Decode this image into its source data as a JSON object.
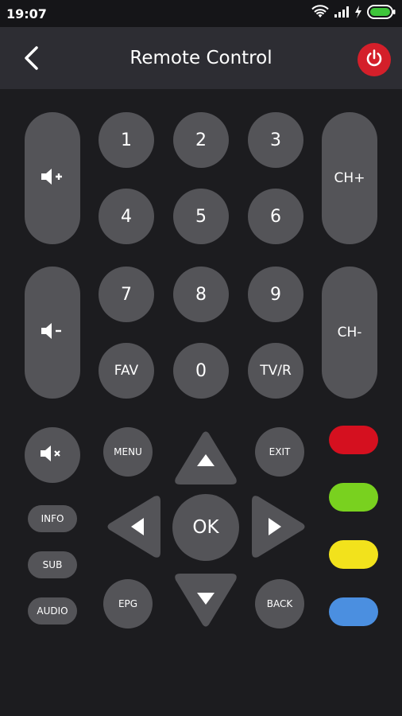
{
  "status": {
    "time": "19:07"
  },
  "appbar": {
    "title": "Remote Control"
  },
  "numbers": [
    "1",
    "2",
    "3",
    "4",
    "5",
    "6",
    "7",
    "8",
    "9",
    "0"
  ],
  "keys": {
    "ch_up": "CH+",
    "ch_down": "CH-",
    "fav": "FAV",
    "tvr": "TV/R",
    "menu": "MENU",
    "exit": "EXIT",
    "ok": "OK",
    "info": "INFO",
    "sub": "SUB",
    "audio": "AUDIO",
    "epg": "EPG",
    "back": "BACK"
  },
  "colors": {
    "background": "#1c1c1f",
    "appbar": "#2d2d33",
    "button": "#545458",
    "power": "#d41f2a",
    "red": "#d5101f",
    "green": "#79d11f",
    "yellow": "#f2e21c",
    "blue": "#4b8fe0"
  },
  "icons": [
    "wifi-icon",
    "signal-icon",
    "charging-icon",
    "battery-icon",
    "back-arrow-icon",
    "power-icon",
    "volume-up-icon",
    "volume-down-icon",
    "mute-icon",
    "arrow-up-icon",
    "arrow-down-icon",
    "arrow-left-icon",
    "arrow-right-icon"
  ]
}
